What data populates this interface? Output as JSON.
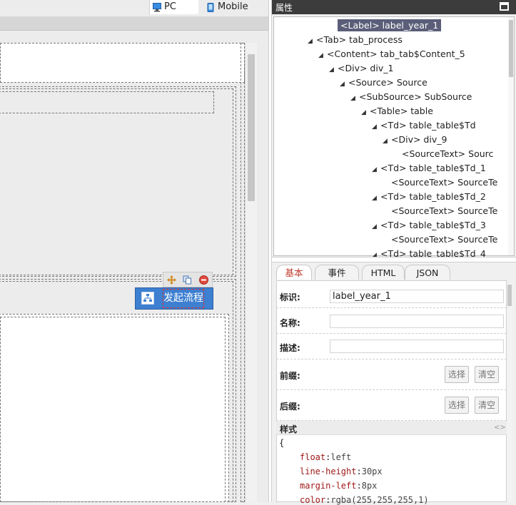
{
  "toolbar": {
    "device_tabs": [
      {
        "label": "PC",
        "active": true
      },
      {
        "label": "Mobile",
        "active": false
      }
    ]
  },
  "selected_control": {
    "label": "发起流程",
    "toolbar_icons": [
      "move-icon",
      "copy-icon",
      "delete-icon"
    ]
  },
  "right_panel": {
    "title": "属性",
    "tree": [
      {
        "text": "<Label> label_year_1",
        "level": 6,
        "arrow": false,
        "selected": true
      },
      {
        "text": "<Tab> tab_process",
        "level": 4,
        "arrow": true,
        "selected": false
      },
      {
        "text": "<Content> tab_tab$Content_5",
        "level": 5,
        "arrow": true,
        "selected": false
      },
      {
        "text": "<Div> div_1",
        "level": 6,
        "arrow": true,
        "selected": false
      },
      {
        "text": "<Source> Source",
        "level": 7,
        "arrow": true,
        "selected": false
      },
      {
        "text": "<SubSource> SubSource",
        "level": 8,
        "arrow": true,
        "selected": false
      },
      {
        "text": "<Table> table",
        "level": 9,
        "arrow": true,
        "selected": false
      },
      {
        "text": "<Td> table_table$Td",
        "level": 10,
        "arrow": true,
        "selected": false
      },
      {
        "text": "<Div> div_9",
        "level": 11,
        "arrow": true,
        "selected": false
      },
      {
        "text": "<SourceText> Sourc",
        "level": 12,
        "arrow": false,
        "selected": false
      },
      {
        "text": "<Td> table_table$Td_1",
        "level": 10,
        "arrow": true,
        "selected": false
      },
      {
        "text": "<SourceText> SourceTe",
        "level": 11,
        "arrow": false,
        "selected": false
      },
      {
        "text": "<Td> table_table$Td_2",
        "level": 10,
        "arrow": true,
        "selected": false
      },
      {
        "text": "<SourceText> SourceTe",
        "level": 11,
        "arrow": false,
        "selected": false
      },
      {
        "text": "<Td> table_table$Td_3",
        "level": 10,
        "arrow": true,
        "selected": false
      },
      {
        "text": "<SourceText> SourceTe",
        "level": 11,
        "arrow": false,
        "selected": false
      },
      {
        "text": "<Td> table_table$Td_4",
        "level": 10,
        "arrow": true,
        "selected": false
      }
    ],
    "tabs": [
      {
        "label": "基本",
        "active": true
      },
      {
        "label": "事件",
        "active": false
      },
      {
        "label": "HTML",
        "active": false
      },
      {
        "label": "JSON",
        "active": false
      }
    ],
    "fields": {
      "id": {
        "label": "标识:",
        "value": "label_year_1"
      },
      "name": {
        "label": "名称:",
        "value": ""
      },
      "desc": {
        "label": "描述:",
        "value": ""
      },
      "prefix": {
        "label": "前缀:",
        "select": "选择",
        "clear": "清空"
      },
      "suffix": {
        "label": "后缀:",
        "select": "选择",
        "clear": "清空"
      }
    },
    "style": {
      "title": "样式",
      "toggle": "<>",
      "open_brace": "{",
      "rules": [
        {
          "prop": "float",
          "value": "left"
        },
        {
          "prop": "line-height",
          "value": "30px"
        },
        {
          "prop": "margin-left",
          "value": "8px"
        },
        {
          "prop": "color",
          "value": "rgba(255,255,255,1)"
        }
      ]
    }
  }
}
